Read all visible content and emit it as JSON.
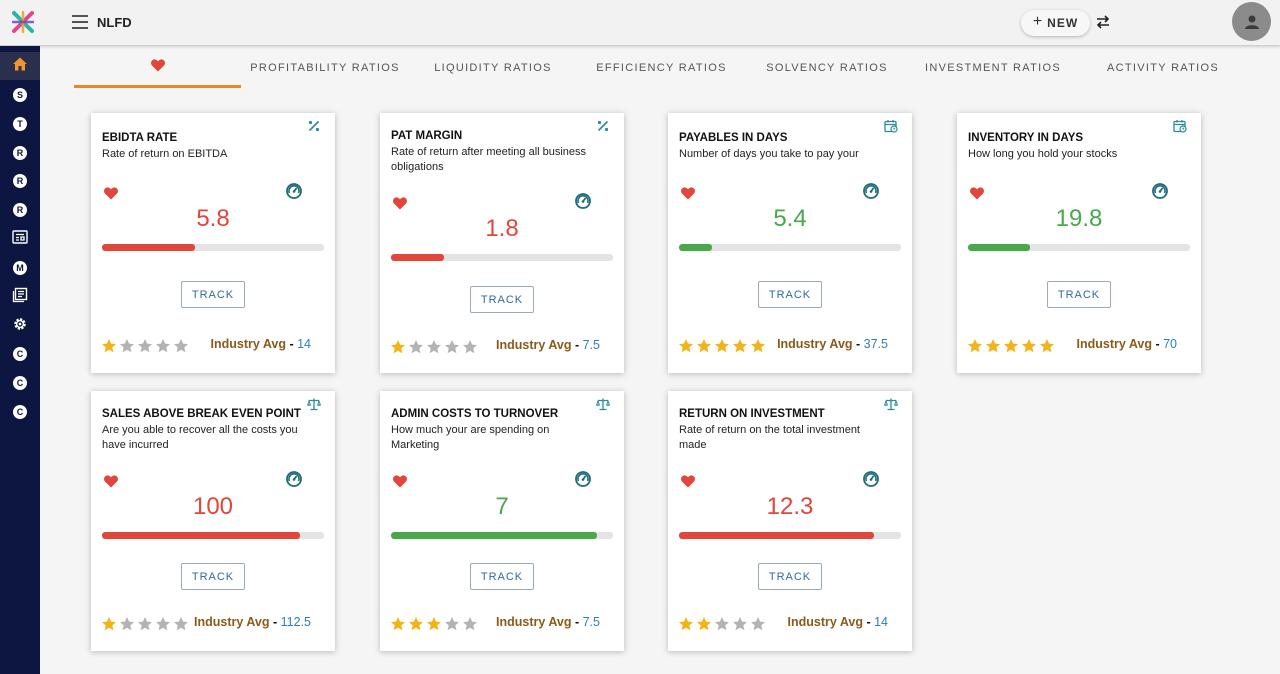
{
  "app": {
    "name": "NLFD",
    "new_label": "NEW"
  },
  "icons": {
    "logo": "x-logo-icon",
    "menu": "hamburger-menu-icon",
    "swap": "swap-arrows-icon",
    "avatar": "user-avatar-icon",
    "favorite": "heart-icon",
    "gauge": "gauge-icon",
    "percent": "percent-icon",
    "calendar": "calendar-clock-icon",
    "scale": "balance-scale-icon",
    "star": "star-icon"
  },
  "colors": {
    "accent": "#e8862a",
    "bad": "#e0463a",
    "good": "#48a84a",
    "sidebar": "#0d1640",
    "star": "#f2b418",
    "star_off": "#b3b3b3",
    "link": "#2f7dbd"
  },
  "sidebar": {
    "items": [
      {
        "icon": "home-icon",
        "letter": "",
        "active": true
      },
      {
        "icon": "s-circle-icon",
        "letter": "S"
      },
      {
        "icon": "t-circle-icon",
        "letter": "T"
      },
      {
        "icon": "r-circle-icon",
        "letter": "R"
      },
      {
        "icon": "r-circle-icon",
        "letter": "R"
      },
      {
        "icon": "r-circle-icon",
        "letter": "R"
      },
      {
        "icon": "report-icon",
        "letter": ""
      },
      {
        "icon": "m-circle-icon",
        "letter": "M"
      },
      {
        "icon": "library-icon",
        "letter": ""
      },
      {
        "icon": "settings-gear-icon",
        "letter": ""
      },
      {
        "icon": "c-circle-icon",
        "letter": "C"
      },
      {
        "icon": "c-circle-icon",
        "letter": "C"
      },
      {
        "icon": "c-circle-icon",
        "letter": "C"
      }
    ]
  },
  "tabs": [
    {
      "label": "",
      "icon": "heart-icon",
      "active": true
    },
    {
      "label": "PROFITABILITY RATIOS"
    },
    {
      "label": "LIQUIDITY RATIOS"
    },
    {
      "label": "EFFICIENCY RATIOS"
    },
    {
      "label": "SOLVENCY RATIOS"
    },
    {
      "label": "INVESTMENT RATIOS"
    },
    {
      "label": "ACTIVITY RATIOS"
    }
  ],
  "cards": [
    {
      "title": "EBIDTA RATE",
      "desc": "Rate of return on EBITDA",
      "type_icon": "percent-icon",
      "value": "5.8",
      "progress": 0.42,
      "status": "bad",
      "track_label": "TRACK",
      "stars": 1,
      "industry_label": "Industry Avg",
      "industry_avg": "14"
    },
    {
      "title": "PAT MARGIN",
      "desc": "Rate of return after meeting all business obligations",
      "type_icon": "percent-icon",
      "value": "1.8",
      "progress": 0.24,
      "status": "bad",
      "track_label": "TRACK",
      "stars": 1,
      "industry_label": "Industry Avg",
      "industry_avg": "7.5"
    },
    {
      "title": "PAYABLES IN DAYS",
      "desc": "Number of days you take to pay your",
      "type_icon": "calendar-clock-icon",
      "value": "5.4",
      "progress": 0.15,
      "status": "good",
      "track_label": "TRACK",
      "stars": 5,
      "industry_label": "Industry Avg",
      "industry_avg": "37.5"
    },
    {
      "title": "INVENTORY IN DAYS",
      "desc": "How long you hold your stocks",
      "type_icon": "calendar-clock-icon",
      "value": "19.8",
      "progress": 0.28,
      "status": "good",
      "track_label": "TRACK",
      "stars": 5,
      "industry_label": "Industry Avg",
      "industry_avg": "70"
    },
    {
      "title": "SALES ABOVE BREAK EVEN POINT",
      "desc": "Are you able to recover all the costs you have incurred",
      "type_icon": "balance-scale-icon",
      "value": "100",
      "progress": 0.89,
      "status": "bad",
      "track_label": "TRACK",
      "stars": 1,
      "industry_label": "Industry Avg",
      "industry_avg": "112.5"
    },
    {
      "title": "ADMIN COSTS TO TURNOVER",
      "desc": "How much your are spending on Marketing",
      "type_icon": "balance-scale-icon",
      "value": "7",
      "progress": 0.93,
      "status": "good",
      "track_label": "TRACK",
      "stars": 3,
      "industry_label": "Industry Avg",
      "industry_avg": "7.5"
    },
    {
      "title": "RETURN ON INVESTMENT",
      "desc": "Rate of return on the total investment made",
      "type_icon": "balance-scale-icon",
      "value": "12.3",
      "progress": 0.88,
      "status": "bad",
      "track_label": "TRACK",
      "stars": 2,
      "industry_label": "Industry Avg",
      "industry_avg": "14"
    }
  ]
}
